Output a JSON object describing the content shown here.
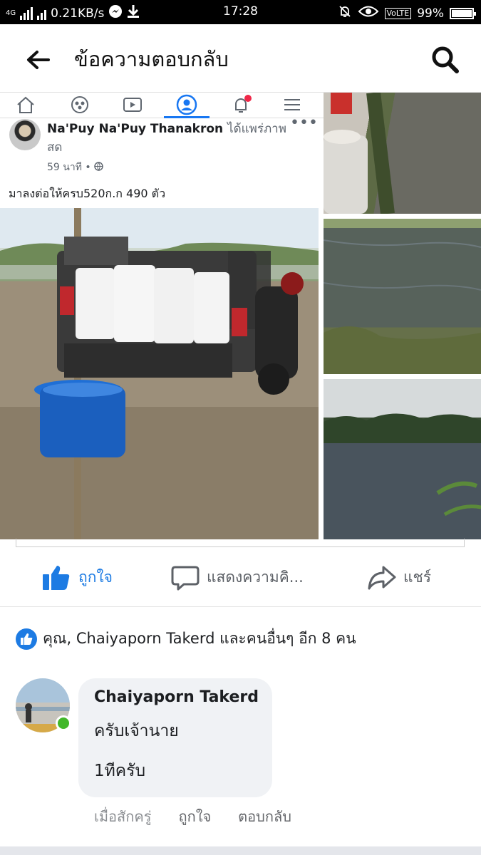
{
  "status_bar": {
    "network": "4G",
    "speed": "0.21KB/s",
    "time": "17:28",
    "volte": "VoLTE",
    "battery": "99%"
  },
  "header": {
    "title": "ข้อความตอบกลับ",
    "back_icon": "arrow-left-icon",
    "search_icon": "search-icon"
  },
  "post": {
    "author": "Na'Puy Na'Puy Thanakron",
    "verb": "ได้แพร่ภาพสด",
    "time": "59 นาที",
    "text": "มาลงต่อให้ครบ520ก.ก 490 ตัว",
    "menu": "•••"
  },
  "actions": {
    "like": "ถูกใจ",
    "comment": "แสดงความคิ...",
    "share": "แชร์"
  },
  "reactions": {
    "text": "คุณ, Chaiyaporn Takerd และคนอื่นๆ อีก 8 คน"
  },
  "comment": {
    "author": "Chaiyaporn Takerd",
    "line1": "ครับเจ้านาย",
    "line2": "1ทีครับ",
    "time": "เมื่อสักครู่",
    "like": "ถูกใจ",
    "reply": "ตอบกลับ"
  },
  "colors": {
    "accent": "#1d7be3",
    "online": "#42b72a",
    "bubble": "#f0f2f5"
  }
}
